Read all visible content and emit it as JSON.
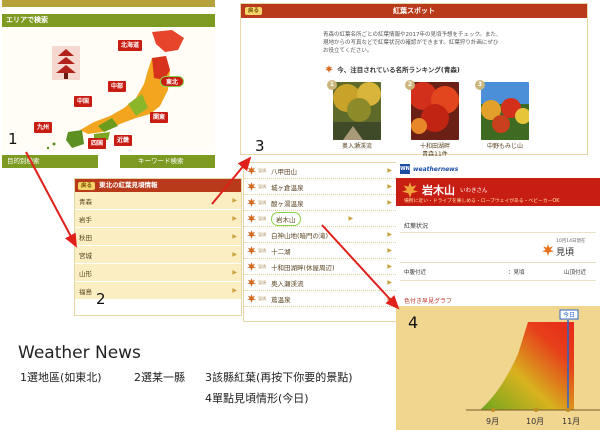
{
  "map_panel": {
    "area_heading": "エリアで検索",
    "regions": [
      "北海道",
      "東北",
      "中部",
      "関東",
      "近畿",
      "中国",
      "四国",
      "九州"
    ],
    "tab_destination": "目的別検索",
    "tab_keyword": "キーワード検索"
  },
  "pref_panel": {
    "back": "戻る",
    "title": "東北の紅葉見頃情報",
    "prefectures": [
      "青森",
      "岩手",
      "秋田",
      "宮城",
      "山形",
      "福島"
    ]
  },
  "rank_panel": {
    "back": "戻る",
    "title": "紅葉スポット",
    "description": "青森の紅葉名所ごとの紅葉情報や2017年の見頃予想をチェック。また、現地からの写真などで紅葉状況の確認ができます。紅葉狩り計画にぜひお役立てください。",
    "ranking_title": "今、注目されている名所ランキング(青森)",
    "photos": [
      {
        "num": "1",
        "caption": "奥入瀬渓流",
        "sub": ""
      },
      {
        "num": "2",
        "caption": "十和田湖畔",
        "sub": "青森11件"
      },
      {
        "num": "3",
        "caption": "中野もみじ山",
        "sub": ""
      }
    ]
  },
  "spots_panel": {
    "spots": [
      {
        "tag": "見頃",
        "name": "八甲田山"
      },
      {
        "tag": "見頃",
        "name": "城ヶ倉温泉"
      },
      {
        "tag": "見頃",
        "name": "酸ヶ湯温泉"
      },
      {
        "tag": "見頃",
        "name": "岩木山"
      },
      {
        "tag": "見頃",
        "name": "白神山地(暗門の滝)"
      },
      {
        "tag": "見頃",
        "name": "十二湖"
      },
      {
        "tag": "見頃",
        "name": "十和田湖畔(休屋周辺)"
      },
      {
        "tag": "見頃",
        "name": "奥入瀬渓流"
      },
      {
        "tag": "見頃",
        "name": "蔦温泉"
      }
    ],
    "selected_index": 3
  },
  "wn_panel": {
    "brand": "weathernews",
    "title": "岩木山",
    "kana": "いわきさん",
    "links": "場所に近い・ドライブを楽しめる・ロープウェイがある・ベビーカーOK",
    "status_label": "紅葉状況",
    "current_date": "10月14日現在",
    "current_value": "見頃",
    "row_mid": "中腹付近",
    "row_mid_value": "：見頃",
    "row_top": "山頂付近",
    "graph_label": "色付き早見グラフ",
    "today_label": "今日",
    "months": [
      "9月",
      "10月",
      "11月"
    ]
  },
  "steps": [
    "1",
    "2",
    "3",
    "4"
  ],
  "caption": {
    "title": "Weather News",
    "line1_a": "1選地區(如東北)",
    "line1_b": "2選某一縣",
    "line1_c": "3該縣紅葉(再按下你要的景點)",
    "line2": "4單點見頃情形(今日)"
  }
}
